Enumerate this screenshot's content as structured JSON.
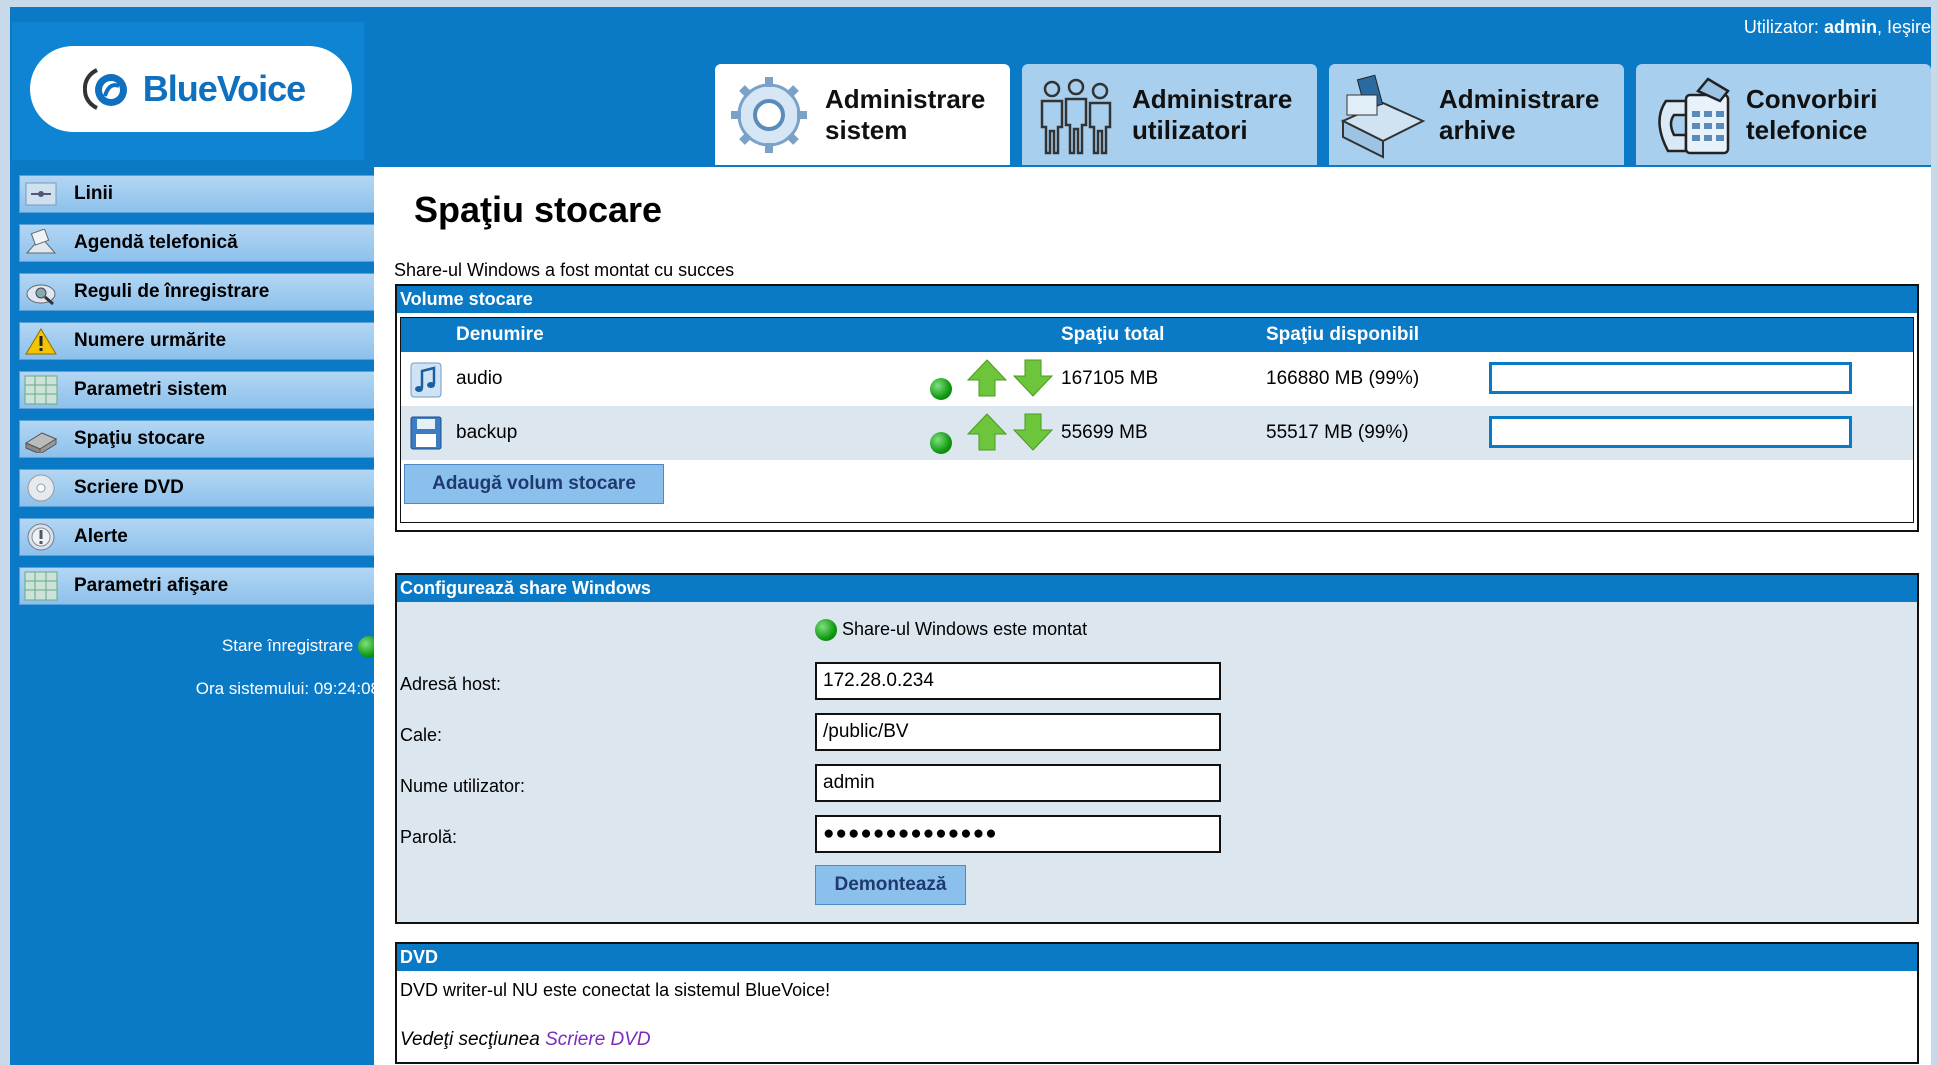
{
  "header": {
    "user_prefix": "Utilizator:",
    "user_name": "admin",
    "logout": "Ieşire"
  },
  "logo": {
    "text": "BlueVoice"
  },
  "tabs": [
    {
      "line1": "Administrare",
      "line2": "sistem",
      "active": true,
      "icon": "gear-icon"
    },
    {
      "line1": "Administrare",
      "line2": "utilizatori",
      "active": false,
      "icon": "users-icon"
    },
    {
      "line1": "Administrare",
      "line2": "arhive",
      "active": false,
      "icon": "archive-icon"
    },
    {
      "line1": "Convorbiri",
      "line2": "telefonice",
      "active": false,
      "icon": "telephone-icon"
    }
  ],
  "sidebar": {
    "items": [
      {
        "label": "Linii",
        "icon": "lines-icon"
      },
      {
        "label": "Agendă telefonică",
        "icon": "phonebook-icon"
      },
      {
        "label": "Reguli de înregistrare",
        "icon": "recording-rules-icon"
      },
      {
        "label": "Numere urmărite",
        "icon": "warning-icon"
      },
      {
        "label": "Parametri sistem",
        "icon": "grid-icon"
      },
      {
        "label": "Spaţiu stocare",
        "icon": "storage-icon"
      },
      {
        "label": "Scriere DVD",
        "icon": "dvd-icon"
      },
      {
        "label": "Alerte",
        "icon": "alert-icon"
      },
      {
        "label": "Parametri afişare",
        "icon": "display-grid-icon"
      }
    ],
    "status_label": "Stare înregistrare",
    "time_label": "Ora sistemului: 09:24:08"
  },
  "page": {
    "title": "Spaţiu stocare",
    "message": "Share-ul Windows a fost montat cu succes"
  },
  "volumes": {
    "panel_title": "Volume stocare",
    "columns": {
      "name": "Denumire",
      "total": "Spaţiu total",
      "free": "Spaţiu disponibil"
    },
    "rows": [
      {
        "name": "audio",
        "total": "167105 MB",
        "free": "166880 MB (99%)",
        "used_fraction": 0.0,
        "icon": "music-note-icon"
      },
      {
        "name": "backup",
        "total": "55699 MB",
        "free": "55517 MB (99%)",
        "used_fraction": 0.0,
        "icon": "floppy-icon"
      }
    ],
    "add_button": "Adaugă volum stocare"
  },
  "share": {
    "panel_title": "Configurează share Windows",
    "status": "Share-ul Windows este montat",
    "host_label": "Adresă host:",
    "host_value": "172.28.0.234",
    "path_label": "Cale:",
    "path_value": "/public/BV",
    "user_label": "Nume utilizator:",
    "user_value": "admin",
    "password_label": "Parolă:",
    "password_value": "●●●●●●●●●●●●●●",
    "unmount_button": "Demontează"
  },
  "dvd": {
    "panel_title": "DVD",
    "message": "DVD writer-ul NU este conectat la sistemul BlueVoice!",
    "see_prefix": "Vedeţi secţiunea",
    "see_link": "Scriere DVD"
  },
  "colors": {
    "brand_blue": "#0a7ac7",
    "tab_inactive": "#a8d0ee",
    "status_green": "#119911"
  }
}
